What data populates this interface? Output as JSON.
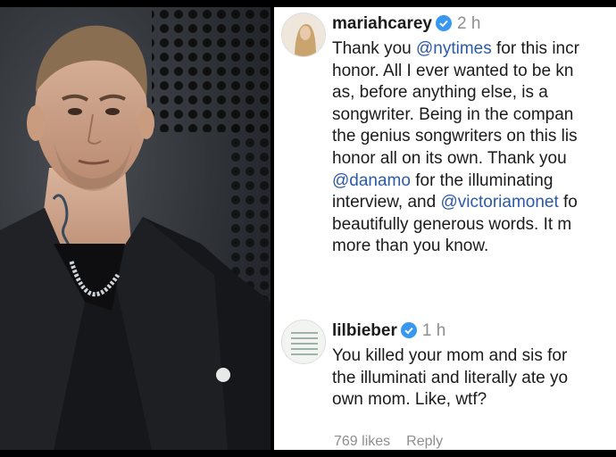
{
  "comments": [
    {
      "username": "mariahcarey",
      "verified": true,
      "time": "2 h",
      "lines": [
        [
          {
            "t": "Thank you "
          },
          {
            "t": "@nytimes",
            "m": true
          },
          {
            "t": " for this incr"
          }
        ],
        [
          {
            "t": "honor. All I ever wanted to be kn"
          }
        ],
        [
          {
            "t": "as, before anything else, is a"
          }
        ],
        [
          {
            "t": "songwriter. Being in the compan"
          }
        ],
        [
          {
            "t": "the genius songwriters on this lis"
          }
        ],
        [
          {
            "t": "honor all on its own. Thank you"
          }
        ],
        [
          {
            "t": "@danamo",
            "m": true
          },
          {
            "t": " for the illuminating"
          }
        ],
        [
          {
            "t": "interview, and "
          },
          {
            "t": "@victoriamonet",
            "m": true
          },
          {
            "t": " fo"
          }
        ],
        [
          {
            "t": "beautifully generous words. It m"
          }
        ],
        [
          {
            "t": "more than you know."
          }
        ]
      ]
    },
    {
      "username": "lilbieber",
      "verified": true,
      "time": "1 h",
      "lines": [
        [
          {
            "t": "You killed your mom and sis for"
          }
        ],
        [
          {
            "t": "the illuminati and literally ate yo"
          }
        ],
        [
          {
            "t": "own mom. Like, wtf?"
          }
        ]
      ],
      "likes": "769 likes",
      "reply": "Reply"
    }
  ],
  "colors": {
    "mention": "#2b5aa8",
    "verified": "#3897f0",
    "muted": "#8e8e8e"
  },
  "icons": {
    "verified": "verified-badge-icon"
  }
}
